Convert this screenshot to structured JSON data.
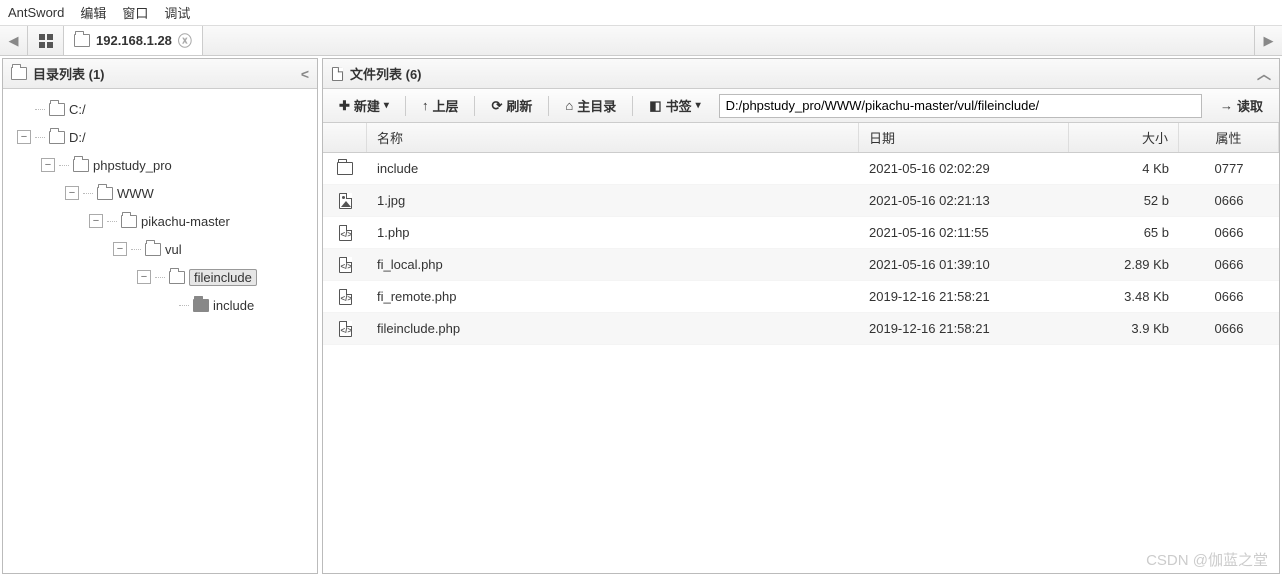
{
  "app": {
    "title": "AntSword"
  },
  "menu": {
    "edit": "编辑",
    "window": "窗口",
    "debug": "调试"
  },
  "tabs": {
    "active_ip": "192.168.1.28"
  },
  "sidebar": {
    "title": "目录列表 (1)",
    "tree": {
      "c": "C:/",
      "d": "D:/",
      "phpstudy": "phpstudy_pro",
      "www": "WWW",
      "pikachu": "pikachu-master",
      "vul": "vul",
      "fileinclude": "fileinclude",
      "include": "include"
    }
  },
  "filelist": {
    "title": "文件列表 (6)",
    "toolbar": {
      "new": "新建",
      "up": "上层",
      "refresh": "刷新",
      "home": "主目录",
      "bookmark": "书签",
      "read": "读取"
    },
    "path": "D:/phpstudy_pro/WWW/pikachu-master/vul/fileinclude/",
    "headers": {
      "name": "名称",
      "date": "日期",
      "size": "大小",
      "attr": "属性"
    },
    "rows": [
      {
        "type": "folder",
        "name": "include",
        "date": "2021-05-16 02:02:29",
        "size": "4 Kb",
        "attr": "0777"
      },
      {
        "type": "image",
        "name": "1.jpg",
        "date": "2021-05-16 02:21:13",
        "size": "52 b",
        "attr": "0666"
      },
      {
        "type": "code",
        "name": "1.php",
        "date": "2021-05-16 02:11:55",
        "size": "65 b",
        "attr": "0666"
      },
      {
        "type": "code",
        "name": "fi_local.php",
        "date": "2021-05-16 01:39:10",
        "size": "2.89 Kb",
        "attr": "0666"
      },
      {
        "type": "code",
        "name": "fi_remote.php",
        "date": "2019-12-16 21:58:21",
        "size": "3.48 Kb",
        "attr": "0666"
      },
      {
        "type": "code",
        "name": "fileinclude.php",
        "date": "2019-12-16 21:58:21",
        "size": "3.9 Kb",
        "attr": "0666"
      }
    ]
  },
  "watermark": "CSDN @伽蓝之堂"
}
